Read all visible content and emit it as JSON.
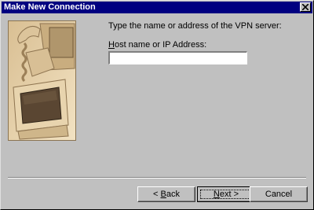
{
  "window": {
    "title": "Make New Connection"
  },
  "content": {
    "prompt": "Type the name or address of the VPN server:",
    "field_label_mnemonic": "H",
    "field_label_rest": "ost name or IP Address:",
    "host_value": "",
    "host_placeholder": ""
  },
  "buttons": {
    "back_arrow": "<",
    "back_mnemonic": "B",
    "back_rest": "ack",
    "next_mnemonic": "N",
    "next_rest": "ext",
    "next_arrow": ">",
    "cancel": "Cancel"
  },
  "icons": {
    "close": "close-icon",
    "picture": "computer-monitors-illustration"
  },
  "colors": {
    "titlebar": "#000080",
    "face": "#c0c0c0",
    "picture_tint": "#e6cfa6"
  }
}
